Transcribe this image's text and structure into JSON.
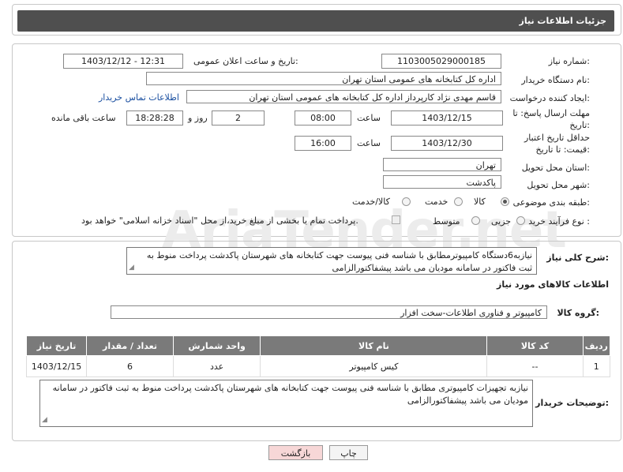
{
  "header": {
    "title": "جزئیات اطلاعات نیاز"
  },
  "watermark": {
    "text": "AriaTender.net"
  },
  "form": {
    "need_number": {
      "label": "شماره نیاز:",
      "value": "1103005029000185"
    },
    "announce_datetime": {
      "label": "تاریخ و ساعت اعلان عمومی:",
      "value": "1403/12/12 - 12:31"
    },
    "buyer_org": {
      "label": "نام دستگاه خریدار:",
      "value": "اداره کل کتابخانه های عمومی استان تهران"
    },
    "requester": {
      "label": "ایجاد کننده درخواست:",
      "value": "قاسم مهدی نژاد کارپرداز اداره کل کتابخانه های عمومی استان تهران",
      "contact_link": "اطلاعات تماس خریدار"
    },
    "reply_deadline": {
      "label": "مهلت ارسال پاسخ: تا تاریخ:",
      "date": "1403/12/15",
      "time_label": "ساعت",
      "time": "08:00",
      "days": "2",
      "days_label": "روز و",
      "remaining": "18:28:28",
      "remaining_label": "ساعت باقی مانده"
    },
    "price_validity": {
      "label": "حداقل تاریخ اعتبار قیمت: تا تاریخ:",
      "date": "1403/12/30",
      "time_label": "ساعت",
      "time": "16:00"
    },
    "delivery_province": {
      "label": "استان محل تحویل:",
      "value": "تهران"
    },
    "delivery_city": {
      "label": "شهر محل تحویل:",
      "value": "پاکدشت"
    },
    "category": {
      "label": "طبقه بندی موضوعی:",
      "options": [
        "کالا",
        "خدمت",
        "کالا/خدمت"
      ],
      "selected": "کالا"
    },
    "process_type": {
      "label": "نوع فرآیند خرید :",
      "options": [
        "جزیی",
        "متوسط"
      ],
      "selected": "",
      "payment_note": "پرداخت تمام یا بخشی از مبلغ خرید،از محل \"اسناد خزانه اسلامی\" خواهد بود."
    }
  },
  "description": {
    "label": "شرح کلی نیاز:",
    "value": "نیازبه6دستگاه کامپیوترمطابق با شناسه فنی پیوست جهت کتابخانه های شهرستان پاکدشت پرداخت منوط به ثبت فاکتور در سامانه مودیان می باشد پیشفاکتورالزامی"
  },
  "goods": {
    "section_title": "اطلاعات کالاهای مورد نیاز",
    "group_label": "گروه کالا:",
    "group_value": "کامپیوتر و فناوری اطلاعات-سخت افزار",
    "columns": [
      "ردیف",
      "کد کالا",
      "نام کالا",
      "واحد شمارش",
      "تعداد / مقدار",
      "تاریخ نیاز"
    ],
    "rows": [
      {
        "index": "1",
        "code": "--",
        "name": "کیس کامپیوتر",
        "unit": "عدد",
        "qty": "6",
        "date": "1403/12/15"
      }
    ]
  },
  "buyer_notes": {
    "label": "توضیحات خریدار:",
    "value": "نیازبه تجهیزات کامپیوتری مطابق با شناسه فنی پیوست جهت کتابخانه های شهرستان پاکدشت پرداخت منوط به ثبت فاکتور در سامانه مودیان می باشد پیشفاکتورالزامی"
  },
  "buttons": {
    "print": "چاپ",
    "back": "بازگشت"
  },
  "colors": {
    "header_bg": "#4f4f4f",
    "table_header_bg": "#7a7a7a",
    "link": "#1a4fa0",
    "back_button_bg": "#f7d7d7"
  }
}
